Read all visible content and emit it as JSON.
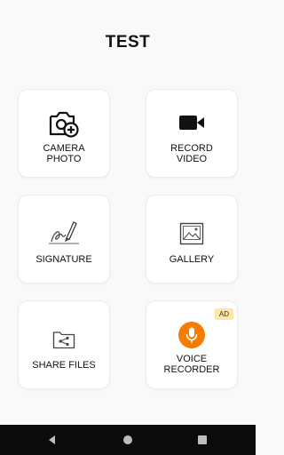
{
  "app": {
    "title": "TEST"
  },
  "tiles": [
    {
      "label": "CAMERA\nPHOTO",
      "icon": "camera-plus-icon"
    },
    {
      "label": "RECORD\nVIDEO",
      "icon": "video-camera-icon"
    },
    {
      "label": "SIGNATURE",
      "icon": "signature-pen-icon"
    },
    {
      "label": "GALLERY",
      "icon": "gallery-image-icon"
    },
    {
      "label": "SHARE FILES",
      "icon": "share-folder-icon"
    },
    {
      "label": "VOICE\nRECORDER",
      "icon": "microphone-icon",
      "badge": "AD",
      "icon_color": "#f57c00"
    }
  ],
  "colors": {
    "ad_badge_bg": "#fce7a8",
    "accent": "#f57c00"
  },
  "navbar": {
    "icons": [
      "back-icon",
      "home-icon",
      "recents-icon"
    ]
  }
}
